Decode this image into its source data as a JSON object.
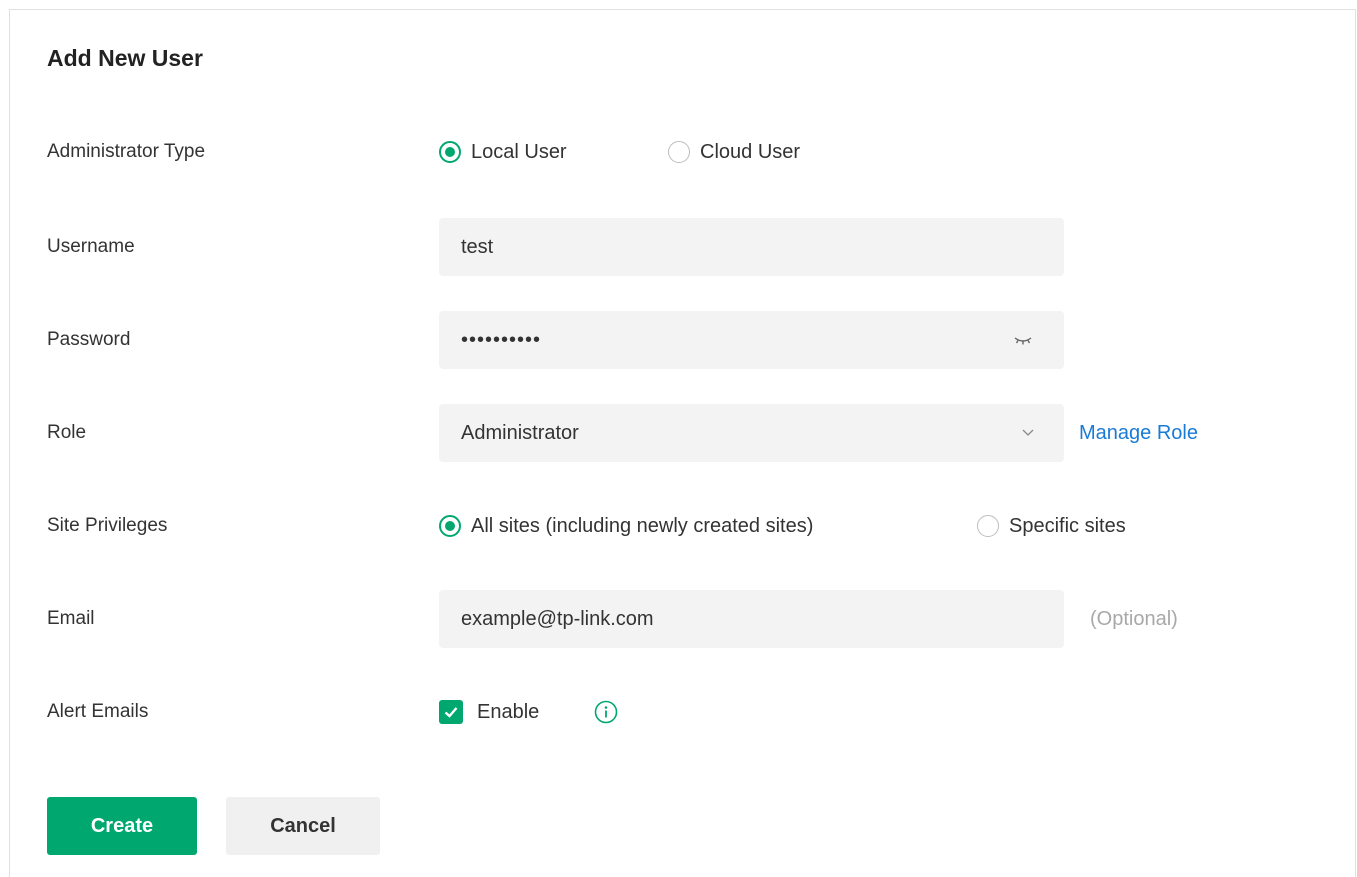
{
  "title": "Add New User",
  "admin_type": {
    "label": "Administrator Type",
    "options": [
      {
        "label": "Local User",
        "selected": true
      },
      {
        "label": "Cloud User",
        "selected": false
      }
    ]
  },
  "username": {
    "label": "Username",
    "value": "test"
  },
  "password": {
    "label": "Password",
    "value": "••••••••••",
    "toggle_icon": "eye-closed-icon"
  },
  "role": {
    "label": "Role",
    "value": "Administrator",
    "link": "Manage Role"
  },
  "site_privileges": {
    "label": "Site Privileges",
    "options": [
      {
        "label": "All sites (including newly created sites)",
        "selected": true
      },
      {
        "label": "Specific sites",
        "selected": false
      }
    ]
  },
  "email": {
    "label": "Email",
    "value": "example@tp-link.com",
    "hint": "(Optional)"
  },
  "alert_emails": {
    "label": "Alert Emails",
    "checkbox_label": "Enable",
    "checked": true
  },
  "buttons": {
    "create": "Create",
    "cancel": "Cancel"
  },
  "colors": {
    "accent": "#00a870",
    "link": "#1a7bd6",
    "field_bg": "#f3f3f3"
  }
}
